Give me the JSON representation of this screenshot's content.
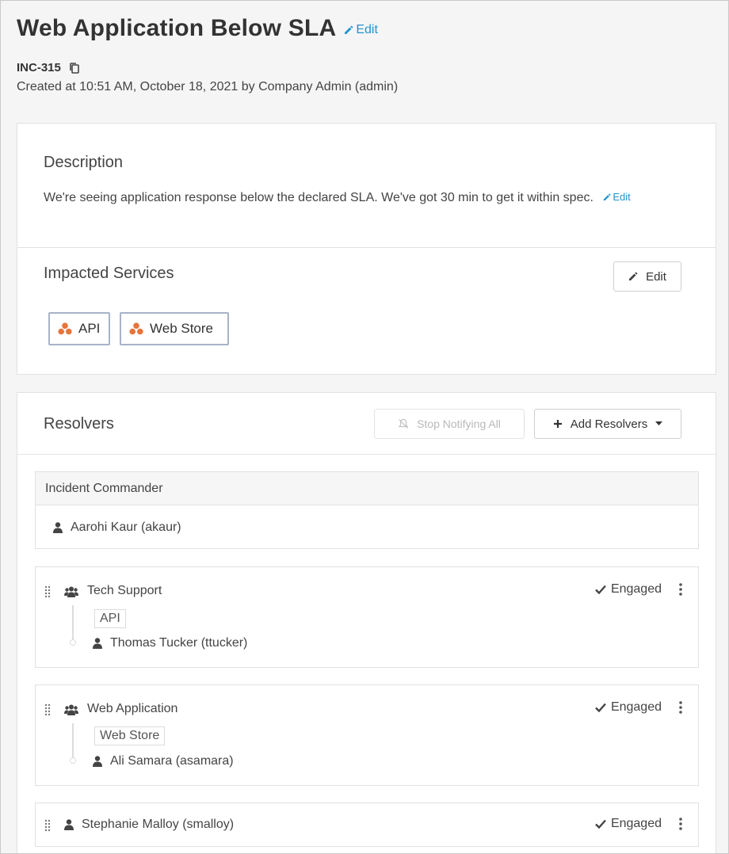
{
  "header": {
    "title": "Web Application Below SLA",
    "edit_label": "Edit",
    "incident_id": "INC-315",
    "created_text": "Created at 10:51 AM, October 18, 2021 by Company Admin (admin)"
  },
  "description": {
    "heading": "Description",
    "text": "We're seeing application response below the declared SLA. We've got 30 min to get it within spec.",
    "edit_label": "Edit"
  },
  "impacted_services": {
    "heading": "Impacted Services",
    "edit_button": "Edit",
    "services": [
      "API",
      "Web Store"
    ]
  },
  "resolvers": {
    "heading": "Resolvers",
    "stop_notifying_label": "Stop Notifying All",
    "add_resolvers_label": "Add Resolvers",
    "incident_commander": {
      "label": "Incident Commander",
      "name": "Aarohi Kaur (akaur)"
    },
    "teams": [
      {
        "name": "Tech Support",
        "service": "API",
        "member": "Thomas Tucker (ttucker)",
        "status": "Engaged"
      },
      {
        "name": "Web Application",
        "service": "Web Store",
        "member": "Ali Samara (asamara)",
        "status": "Engaged"
      }
    ],
    "individual": {
      "name": "Stephanie Malloy (smalloy)",
      "status": "Engaged"
    }
  },
  "colors": {
    "link": "#1f94cf",
    "service_icon": "#e8743b",
    "chip_border": "#a8b3c7"
  },
  "icons": [
    "pencil-icon",
    "copy-icon",
    "service-icon",
    "mute-icon",
    "plus-icon",
    "caret-down-icon",
    "person-icon",
    "team-icon",
    "drag-handle-icon",
    "check-icon",
    "kebab-icon"
  ]
}
